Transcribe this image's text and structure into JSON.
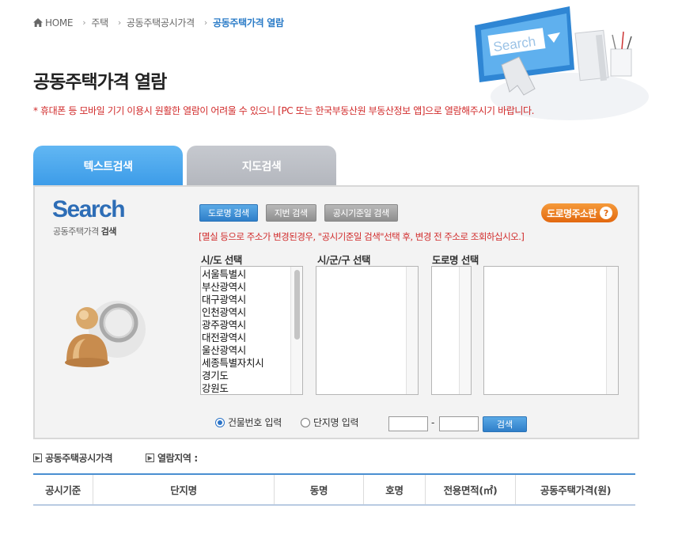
{
  "breadcrumb": {
    "items": [
      "HOME",
      "주택",
      "공동주택공시가격",
      "공동주택가격 열람"
    ]
  },
  "hero": {
    "search_text": "Search"
  },
  "page": {
    "title": "공동주택가격 열람",
    "notice": "* 휴대폰 등 모바일 기기 이용시 원활한 열람이 어려울 수 있으니 [PC 또는 한국부동산원 부동산정보 앱]으로 열람해주시기 바랍니다."
  },
  "tabs": [
    {
      "label": "텍스트검색",
      "active": true
    },
    {
      "label": "지도검색",
      "active": false
    }
  ],
  "panel": {
    "logo": "Search",
    "logo_sub_a": "공동주택가격",
    "logo_sub_b": "검색",
    "buttons": [
      "도로명 검색",
      "지번 검색",
      "공시기준일 검색"
    ],
    "address_button": "도로명주소란",
    "address_help": "?",
    "note": "[멸실 등으로 주소가 변경된경우, \"공시기준일 검색\"선택 후, 변경 전 주소로 조회하십시오.]",
    "col_labels": [
      "시/도 선택",
      "시/군/구 선택",
      "도로명 선택"
    ],
    "sido_list": [
      "서울특별시",
      "부산광역시",
      "대구광역시",
      "인천광역시",
      "광주광역시",
      "대전광역시",
      "울산광역시",
      "세종특별자치시",
      "경기도",
      "강원도"
    ],
    "radio_options": [
      {
        "label": "건물번호 입력",
        "checked": true
      },
      {
        "label": "단지명 입력",
        "checked": false
      }
    ],
    "dash": "-",
    "search_button": "검색"
  },
  "info": {
    "left": "공동주택공시가격",
    "right": "열람지역 :"
  },
  "table": {
    "headers": [
      "공시기준",
      "단지명",
      "동명",
      "호명",
      "전용면적(㎡)",
      "공동주택가격(원)"
    ]
  },
  "colors": {
    "accent_blue": "#3b9be8",
    "notice_red": "#d12b2b",
    "address_orange": "#e2680f"
  }
}
